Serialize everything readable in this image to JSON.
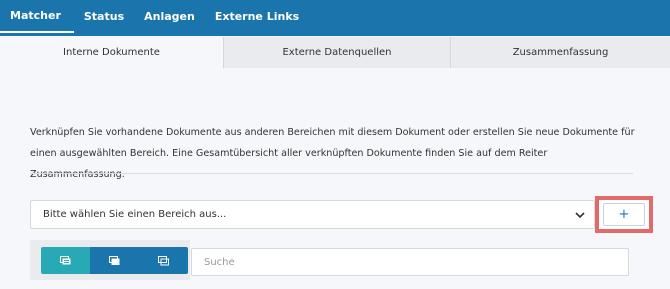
{
  "topnav": {
    "items": [
      {
        "label": "Matcher"
      },
      {
        "label": "Status"
      },
      {
        "label": "Anlagen"
      },
      {
        "label": "Externe Links"
      }
    ]
  },
  "tabs": [
    {
      "label": "Interne Dokumente"
    },
    {
      "label": "Externe Datenquellen"
    },
    {
      "label": "Zusammenfassung"
    }
  ],
  "main": {
    "description": "Verknüpfen Sie vorhandene Dokumente aus anderen Bereichen mit diesem Dokument oder erstellen Sie neue Dokumente für einen ausgewählten Bereich. Eine Gesamtübersicht aller verknüpften Dokumente finden Sie auf dem Reiter Zusammenfassung.",
    "area_select": {
      "value": "Bitte wählen Sie einen Bereich aus..."
    },
    "add_button": {
      "label": "+"
    },
    "search": {
      "placeholder": "Suche"
    }
  },
  "colors": {
    "nav_bg": "#1b75ad",
    "accent_teal": "#27a9b6",
    "highlight_red": "#e46a6a"
  }
}
